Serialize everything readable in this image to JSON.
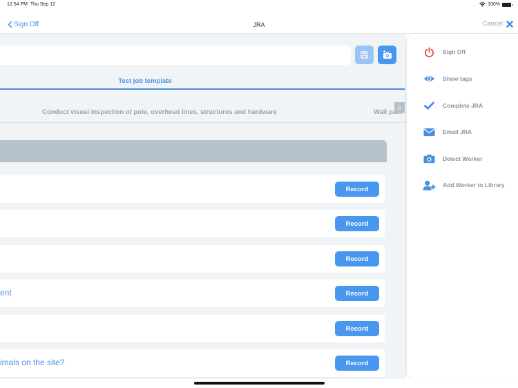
{
  "status_bar": {
    "time": "12:54 PM",
    "date": "Thu Sep 12",
    "signal": "....",
    "wifi_icon": "wifi-icon",
    "battery": "100%"
  },
  "nav": {
    "back_label": "Sign Off",
    "title": "JRA",
    "cancel_label": "Cancel"
  },
  "main": {
    "text_field_value": "",
    "tab_title": "Test job template",
    "steps": [
      "Conduct visual inspection of pole, overhead lines, structures and hardware",
      "Wall pa..."
    ],
    "expand_glyph": "»",
    "rows": [
      {
        "text": "",
        "button": "Record"
      },
      {
        "text": "",
        "button": "Record"
      },
      {
        "text": "",
        "button": "Record"
      },
      {
        "text": "ent",
        "button": "Record"
      },
      {
        "text": "",
        "button": "Record"
      },
      {
        "text": "imals on the site?",
        "button": "Record"
      }
    ]
  },
  "side_menu": {
    "items": [
      {
        "label": "Sign Off",
        "icon": "power-icon",
        "color": "#e0524f"
      },
      {
        "label": "Show tags",
        "icon": "eye-icon",
        "color": "#4a90e2"
      },
      {
        "label": "Complete JRA",
        "icon": "check-icon",
        "color": "#4a90e2"
      },
      {
        "label": "Email JRA",
        "icon": "envelope-icon",
        "color": "#4a90e2"
      },
      {
        "label": "Detect Worker",
        "icon": "camera-icon",
        "color": "#4a90e2"
      },
      {
        "label": "Add Worker to Library",
        "icon": "add-user-icon",
        "color": "#4a90e2"
      }
    ]
  },
  "colors": {
    "accent": "#4a90e2",
    "button": "#4a97ef",
    "danger": "#e0524f",
    "background": "#f1f4f7"
  }
}
